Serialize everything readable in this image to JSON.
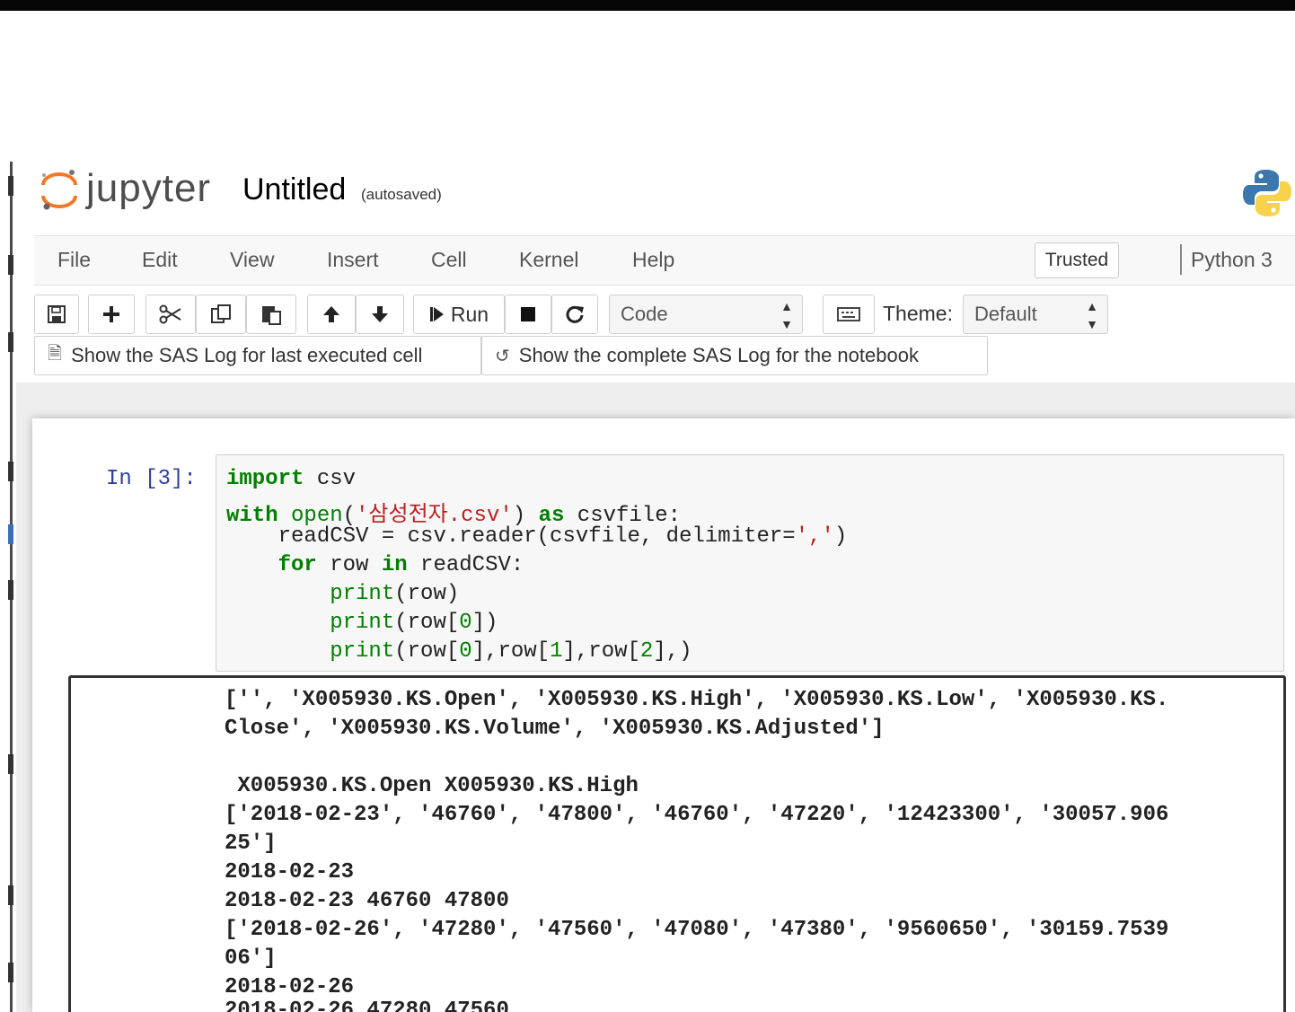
{
  "header": {
    "logo_text": "jupyter",
    "notebook_title": "Untitled",
    "autosave_status": "(autosaved)"
  },
  "menu": {
    "items": [
      "File",
      "Edit",
      "View",
      "Insert",
      "Cell",
      "Kernel",
      "Help"
    ],
    "trusted": "Trusted",
    "kernel": "Python 3"
  },
  "toolbar": {
    "run_label": "Run",
    "cell_type": "Code",
    "theme_label": "Theme:",
    "theme_value": "Default",
    "sas_last_cell": "Show the SAS Log for last executed cell",
    "sas_notebook": "Show the complete SAS Log for the notebook"
  },
  "cell": {
    "prompt": "In [3]:",
    "code": {
      "l1_kw": "import",
      "l1_rest": " csv",
      "l2_kw": "with",
      "l2_sp": " ",
      "l2_fn": "open",
      "l2_p": "(",
      "l2_str": "'삼성전자.csv'",
      "l2_mid": ") ",
      "l2_kw2": "as",
      "l2_rest": " csvfile:",
      "l3_a": "    readCSV = csv.reader(csvfile, delimiter=",
      "l3_str": "','",
      "l3_b": ")",
      "l4_ind": "    ",
      "l4_kw": "for",
      "l4_mid": " row ",
      "l4_kw2": "in",
      "l4_rest": " readCSV:",
      "l5_ind": "        ",
      "l5_fn": "print",
      "l5_rest": "(row)",
      "l6_ind": "        ",
      "l6_fn": "print",
      "l6_a": "(row[",
      "l6_n": "0",
      "l6_b": "])",
      "l7_ind": "        ",
      "l7_fn": "print",
      "l7_a": "(row[",
      "l7_n1": "0",
      "l7_b": "],row[",
      "l7_n2": "1",
      "l7_c": "],row[",
      "l7_n3": "2",
      "l7_d": "],)"
    },
    "output": [
      "['', 'X005930.KS.Open', 'X005930.KS.High', 'X005930.KS.Low', 'X005930.KS.",
      "Close', 'X005930.KS.Volume', 'X005930.KS.Adjusted']",
      "",
      " X005930.KS.Open X005930.KS.High",
      "['2018-02-23', '46760', '47800', '46760', '47220', '12423300', '30057.906",
      "25']",
      "2018-02-23",
      "2018-02-23 46760 47800",
      "['2018-02-26', '47280', '47560', '47080', '47380', '9560650', '30159.7539",
      "06']",
      "2018-02-26",
      "2018-02-26 47280 47560"
    ]
  }
}
